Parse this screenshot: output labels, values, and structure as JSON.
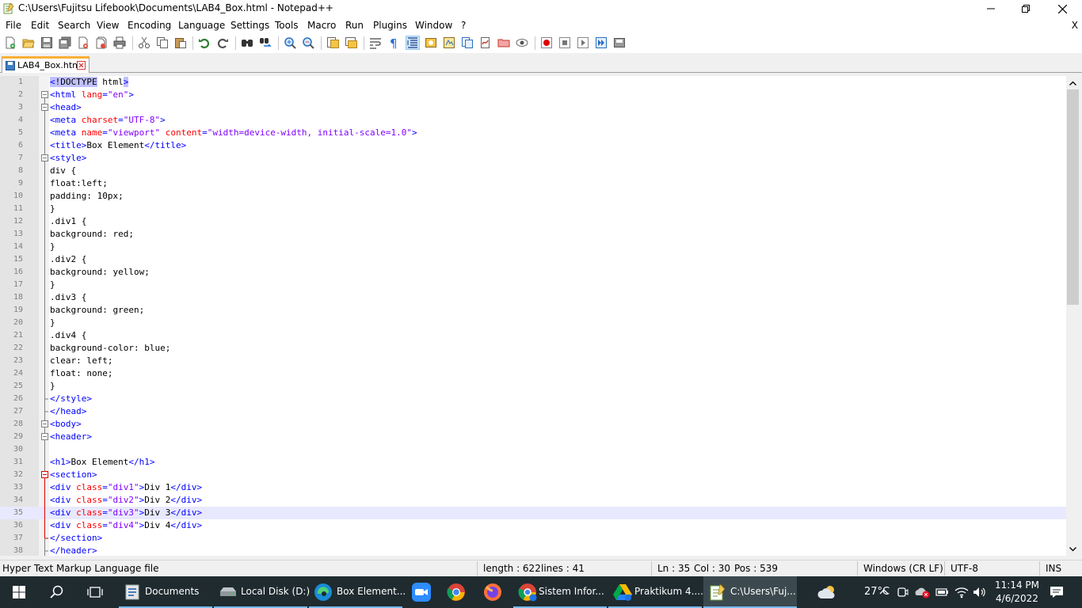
{
  "window": {
    "title": "C:\\Users\\Fujitsu Lifebook\\Documents\\LAB4_Box.html - Notepad++"
  },
  "menu": {
    "items": [
      "File",
      "Edit",
      "Search",
      "View",
      "Encoding",
      "Language",
      "Settings",
      "Tools",
      "Macro",
      "Run",
      "Plugins",
      "Window",
      "?"
    ],
    "close_label": "X"
  },
  "toolbar": {
    "icons": [
      "new-file-icon",
      "open-file-icon",
      "save-icon",
      "save-all-icon",
      "close-icon",
      "close-all-icon",
      "print-icon",
      "cut-icon",
      "copy-icon",
      "paste-icon",
      "undo-icon",
      "redo-icon",
      "find-icon",
      "replace-icon",
      "zoom-in-icon",
      "zoom-out-icon",
      "sync-vertical-icon",
      "sync-horizontal-icon",
      "word-wrap-icon",
      "show-all-chars-icon",
      "indent-guide-icon",
      "user-defined-lang-icon",
      "doc-map-icon",
      "function-list-icon",
      "folder-workspace-icon",
      "monitoring-icon",
      "record-macro-icon",
      "stop-macro-icon",
      "play-macro-icon",
      "run-macro-multiple-icon",
      "save-macro-icon"
    ]
  },
  "tab": {
    "label": "LAB4_Box.html"
  },
  "editor": {
    "current_line": 35,
    "lines": [
      {
        "n": "1",
        "fold": "none",
        "parts": [
          [
            "tg hl",
            "<"
          ],
          [
            "dt hl",
            "!DOCTYPE"
          ],
          [
            "dt",
            " html"
          ],
          [
            "tg hl",
            ">"
          ]
        ]
      },
      {
        "n": "2",
        "fold": "open",
        "parts": [
          [
            "tg",
            "<html "
          ],
          [
            "at",
            "lang"
          ],
          [
            "tg",
            "="
          ],
          [
            "vl",
            "\"en\""
          ],
          [
            "tg",
            ">"
          ]
        ]
      },
      {
        "n": "3",
        "fold": "open",
        "parts": [
          [
            "tg",
            "<head>"
          ]
        ]
      },
      {
        "n": "4",
        "fold": "line",
        "parts": [
          [
            "tg",
            "<meta "
          ],
          [
            "at",
            "charset"
          ],
          [
            "tg",
            "="
          ],
          [
            "vl",
            "\"UTF-8\""
          ],
          [
            "tg",
            ">"
          ]
        ]
      },
      {
        "n": "5",
        "fold": "line",
        "parts": [
          [
            "tg",
            "<meta "
          ],
          [
            "at",
            "name"
          ],
          [
            "tg",
            "="
          ],
          [
            "vl",
            "\"viewport\""
          ],
          [
            "dt",
            " "
          ],
          [
            "at",
            "content"
          ],
          [
            "tg",
            "="
          ],
          [
            "vl",
            "\"width=device-width, initial-scale=1.0\""
          ],
          [
            "tg",
            ">"
          ]
        ]
      },
      {
        "n": "6",
        "fold": "line",
        "parts": [
          [
            "tg",
            "<title>"
          ],
          [
            "dt",
            "Box Element"
          ],
          [
            "tg",
            "</title>"
          ]
        ]
      },
      {
        "n": "7",
        "fold": "open",
        "parts": [
          [
            "tg",
            "<style>"
          ]
        ]
      },
      {
        "n": "8",
        "fold": "line",
        "parts": [
          [
            "dt",
            "div {"
          ]
        ]
      },
      {
        "n": "9",
        "fold": "line",
        "parts": [
          [
            "dt",
            "float:left;"
          ]
        ]
      },
      {
        "n": "10",
        "fold": "line",
        "parts": [
          [
            "dt",
            "padding: 10px;"
          ]
        ]
      },
      {
        "n": "11",
        "fold": "line",
        "parts": [
          [
            "dt",
            "}"
          ]
        ]
      },
      {
        "n": "12",
        "fold": "line",
        "parts": [
          [
            "dt",
            ".div1 {"
          ]
        ]
      },
      {
        "n": "13",
        "fold": "line",
        "parts": [
          [
            "dt",
            "background: red;"
          ]
        ]
      },
      {
        "n": "14",
        "fold": "line",
        "parts": [
          [
            "dt",
            "}"
          ]
        ]
      },
      {
        "n": "15",
        "fold": "line",
        "parts": [
          [
            "dt",
            ".div2 {"
          ]
        ]
      },
      {
        "n": "16",
        "fold": "line",
        "parts": [
          [
            "dt",
            "background: yellow;"
          ]
        ]
      },
      {
        "n": "17",
        "fold": "line",
        "parts": [
          [
            "dt",
            "}"
          ]
        ]
      },
      {
        "n": "18",
        "fold": "line",
        "parts": [
          [
            "dt",
            ".div3 {"
          ]
        ]
      },
      {
        "n": "19",
        "fold": "line",
        "parts": [
          [
            "dt",
            "background: green;"
          ]
        ]
      },
      {
        "n": "20",
        "fold": "line",
        "parts": [
          [
            "dt",
            "}"
          ]
        ]
      },
      {
        "n": "21",
        "fold": "line",
        "parts": [
          [
            "dt",
            ".div4 {"
          ]
        ]
      },
      {
        "n": "22",
        "fold": "line",
        "parts": [
          [
            "dt",
            "background-color: blue;"
          ]
        ]
      },
      {
        "n": "23",
        "fold": "line",
        "parts": [
          [
            "dt",
            "clear: left;"
          ]
        ]
      },
      {
        "n": "24",
        "fold": "line",
        "parts": [
          [
            "dt",
            "float: none;"
          ]
        ]
      },
      {
        "n": "25",
        "fold": "line",
        "parts": [
          [
            "dt",
            "}"
          ]
        ]
      },
      {
        "n": "26",
        "fold": "end",
        "parts": [
          [
            "tg",
            "</style>"
          ]
        ]
      },
      {
        "n": "27",
        "fold": "end",
        "parts": [
          [
            "tg",
            "</head>"
          ]
        ]
      },
      {
        "n": "28",
        "fold": "open",
        "parts": [
          [
            "tg",
            "<body>"
          ]
        ]
      },
      {
        "n": "29",
        "fold": "open",
        "parts": [
          [
            "tg",
            "<header>"
          ]
        ]
      },
      {
        "n": "30",
        "fold": "line",
        "parts": []
      },
      {
        "n": "31",
        "fold": "line",
        "parts": [
          [
            "tg",
            "<h1>"
          ],
          [
            "dt",
            "Box Element"
          ],
          [
            "tg",
            "</h1>"
          ]
        ]
      },
      {
        "n": "32",
        "fold": "open-red",
        "parts": [
          [
            "tg",
            "<section>"
          ]
        ]
      },
      {
        "n": "33",
        "fold": "line-red",
        "parts": [
          [
            "tg",
            "<div "
          ],
          [
            "at",
            "class"
          ],
          [
            "tg",
            "="
          ],
          [
            "vl",
            "\"div1\""
          ],
          [
            "tg",
            ">"
          ],
          [
            "dt",
            "Div 1"
          ],
          [
            "tg",
            "</div>"
          ]
        ]
      },
      {
        "n": "34",
        "fold": "line-red",
        "parts": [
          [
            "tg",
            "<div "
          ],
          [
            "at",
            "class"
          ],
          [
            "tg",
            "="
          ],
          [
            "vl",
            "\"div2\""
          ],
          [
            "tg",
            ">"
          ],
          [
            "dt",
            "Div 2"
          ],
          [
            "tg",
            "</div>"
          ]
        ]
      },
      {
        "n": "35",
        "fold": "line-red",
        "parts": [
          [
            "tg",
            "<div "
          ],
          [
            "at",
            "class"
          ],
          [
            "tg",
            "="
          ],
          [
            "vl",
            "\"div3\""
          ],
          [
            "tg",
            ">"
          ],
          [
            "dt",
            "Div 3"
          ],
          [
            "tg",
            "</div>"
          ]
        ]
      },
      {
        "n": "36",
        "fold": "line-red",
        "parts": [
          [
            "tg",
            "<div "
          ],
          [
            "at",
            "class"
          ],
          [
            "tg",
            "="
          ],
          [
            "vl",
            "\"div4\""
          ],
          [
            "tg",
            ">"
          ],
          [
            "dt",
            "Div 4"
          ],
          [
            "tg",
            "</div>"
          ]
        ]
      },
      {
        "n": "37",
        "fold": "end-red",
        "parts": [
          [
            "tg",
            "</section>"
          ]
        ]
      },
      {
        "n": "38",
        "fold": "end",
        "parts": [
          [
            "tg",
            "</header>"
          ]
        ]
      }
    ]
  },
  "status": {
    "file_type": "Hyper Text Markup Language file",
    "length": "length : 622",
    "lines": "lines : 41",
    "ln": "Ln : 35",
    "col": "Col : 30",
    "pos": "Pos : 539",
    "eol": "Windows (CR LF)",
    "encoding": "UTF-8",
    "mode": "INS"
  },
  "taskbar": {
    "apps": {
      "documents": "Documents",
      "local_disk": "Local Disk (D:)",
      "edge": "Box Element...",
      "chrome_sistem": "Sistem Infor...",
      "drive_praktikum": "Praktikum 4....",
      "notepad": "C:\\Users\\Fuj..."
    },
    "weather": "27°C",
    "time": "11:14 PM",
    "date": "4/6/2022"
  },
  "colors": {
    "tag": "#0000ff",
    "attribute": "#ff0000",
    "value": "#8000ff",
    "current_line": "#e8e8ff",
    "tab_accent": "#fab036",
    "taskbar": "#1f2b2f"
  }
}
